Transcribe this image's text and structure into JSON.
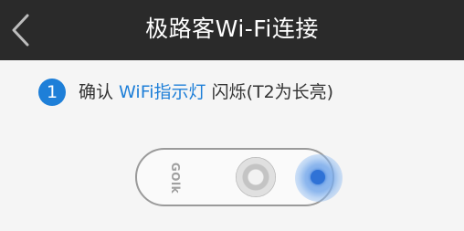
{
  "header": {
    "back_icon": "chevron-left-icon",
    "title": "极路客Wi-Fi连接"
  },
  "step": {
    "number": "1",
    "prefix": "确认 ",
    "highlight": "WiFi指示灯",
    "suffix": " 闪烁(T2为长亮)"
  },
  "device": {
    "logo_text": "GOlk",
    "led_color": "#2f72d6"
  },
  "colors": {
    "header_bg": "#2a2a2a",
    "accent": "#1e7fd8",
    "background": "#f5f5f5"
  }
}
